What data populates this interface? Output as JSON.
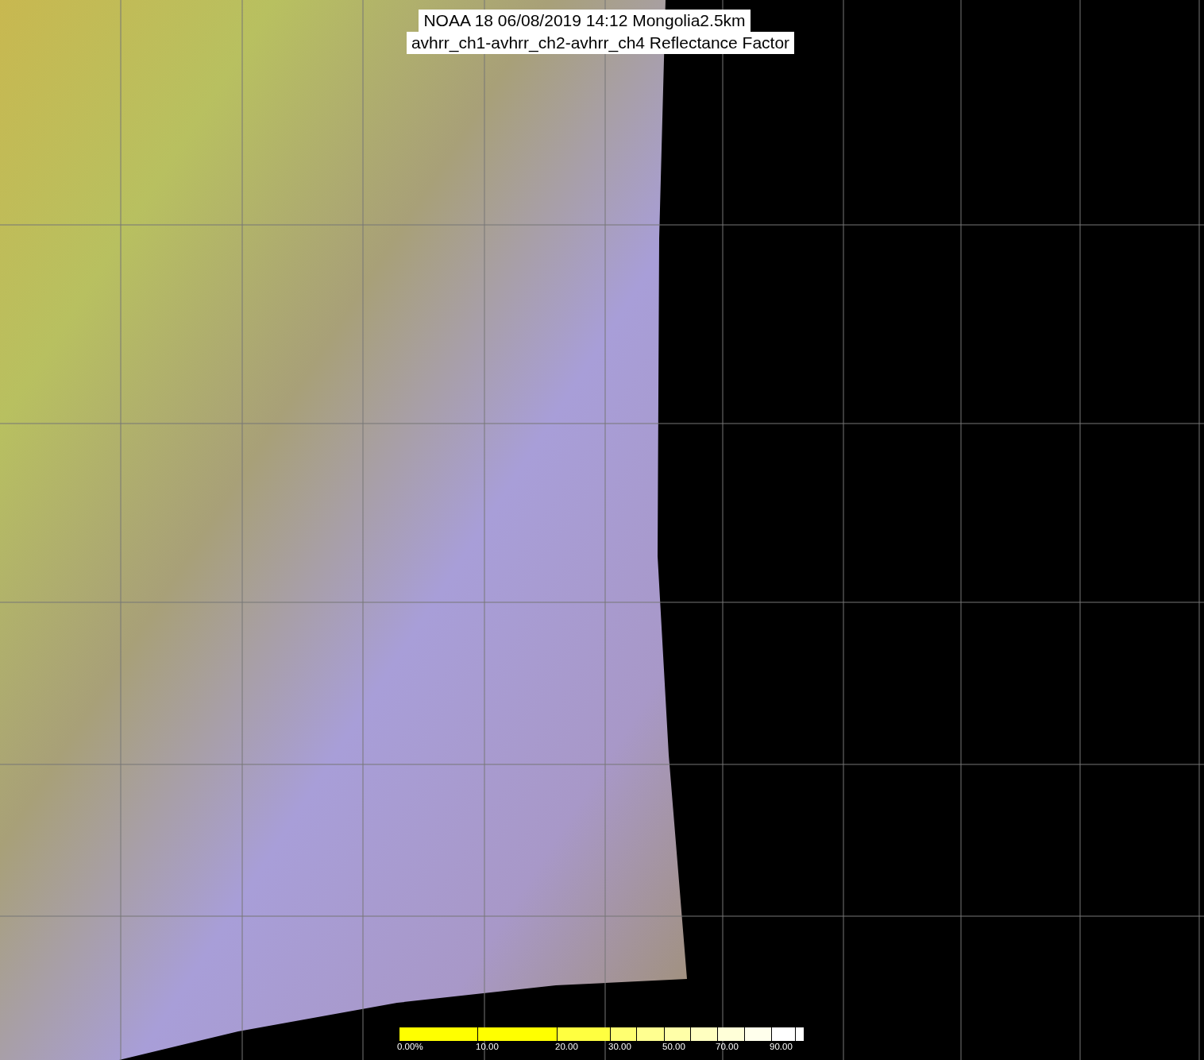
{
  "title": {
    "lines": [
      "NOAA 18 06/08/2019 14:12 Mongolia2.5km",
      "avhrr_ch1-avhrr_ch2-avhrr_ch4 Reflectance Factor"
    ]
  },
  "legend": {
    "segments": [
      {
        "color": "#ffff00",
        "label": "0.00%"
      },
      {
        "color": "#ffff00",
        "label": "10.00"
      },
      {
        "color": "#ffff40",
        "label": "20.00"
      },
      {
        "color": "#ffff70",
        "label": "30.00"
      },
      {
        "color": "#ffff90"
      },
      {
        "color": "#ffffa8",
        "label": "50.00"
      },
      {
        "color": "#ffffc0"
      },
      {
        "color": "#ffffd8",
        "label": "70.00"
      },
      {
        "color": "#ffffec"
      },
      {
        "color": "#ffffff",
        "label": "90.00"
      },
      {
        "color": "#ffffff"
      }
    ]
  }
}
